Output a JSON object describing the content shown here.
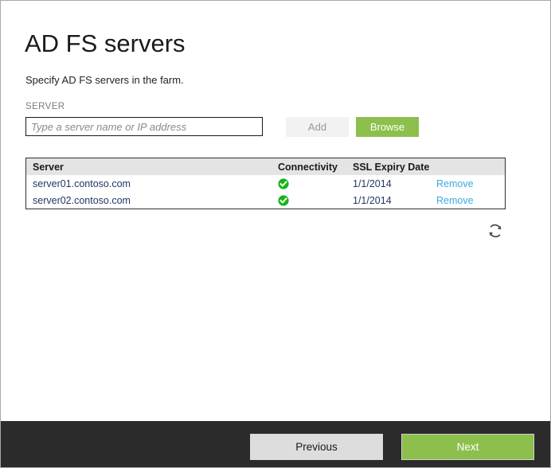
{
  "window": {
    "title": "AD FS servers",
    "subtitle": "Specify AD FS servers in the farm."
  },
  "form": {
    "server_label": "SERVER",
    "server_input_value": "",
    "server_input_placeholder": "Type a server name or IP address",
    "add_label": "Add",
    "browse_label": "Browse",
    "refresh_icon": "refresh-icon"
  },
  "table": {
    "columns": [
      "Server",
      "Connectivity",
      "SSL Expiry Date",
      ""
    ],
    "rows": [
      {
        "server": "server01.contoso.com",
        "connectivity_icon": "green-check-icon",
        "ssl_expiry": "1/1/2014",
        "action": "Remove"
      },
      {
        "server": "server02.contoso.com",
        "connectivity_icon": "green-check-icon",
        "ssl_expiry": "1/1/2014",
        "action": "Remove"
      }
    ]
  },
  "footer": {
    "previous_label": "Previous",
    "next_label": "Next"
  },
  "colors": {
    "accent_green": "#8dbf4d",
    "link_blue": "#3aa9e0",
    "footer_dark": "#2b2b2b",
    "status_ok": "#19b319"
  }
}
